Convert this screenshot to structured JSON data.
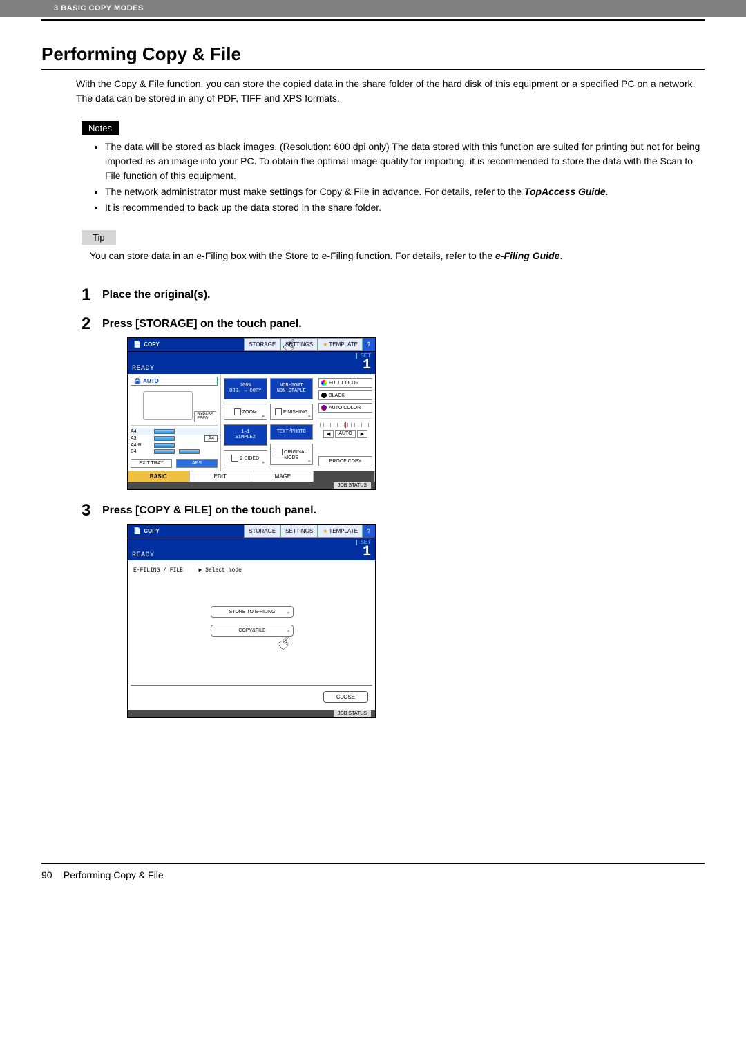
{
  "header": {
    "chapter": "3 BASIC COPY MODES"
  },
  "title": "Performing Copy & File",
  "intro": "With the Copy & File function, you can store the copied data in the share folder of the hard disk of this equipment or a specified PC on a network. The data can be stored in any of PDF, TIFF and XPS formats.",
  "notes": {
    "label": "Notes",
    "items": [
      "The data will be stored as black images. (Resolution: 600 dpi only) The data stored with this function are suited for printing but not for being imported as an image into your PC. To obtain the optimal image quality for importing, it is recommended to store the data with the Scan to File function of this equipment.",
      "The network administrator must make settings for Copy & File in advance. For details, refer to the TopAccess Guide.",
      "It is recommended to back up the data stored in the share folder."
    ],
    "bold_ref1": "TopAccess Guide"
  },
  "tip": {
    "label": "Tip",
    "text_pre": "You can store data in an e-Filing box with the Store to e-Filing function. For details, refer to the ",
    "bold_ref": "e-Filing Guide",
    "text_post": "."
  },
  "steps": [
    {
      "num": "1",
      "title": "Place the original(s)."
    },
    {
      "num": "2",
      "title": "Press [STORAGE] on the touch panel."
    },
    {
      "num": "3",
      "title": "Press [COPY & FILE] on the touch panel."
    }
  ],
  "panel1": {
    "copy_tab": "COPY",
    "storage": "STORAGE",
    "settings": "SETTINGS",
    "template": "TEMPLATE",
    "help": "?",
    "ready": "READY",
    "set": "SET",
    "count": "1",
    "auto": "AUTO",
    "zoom_top": "100%\nORG. → COPY",
    "zoom": "ZOOM",
    "finishing_top": "NON-SORT\nNON-STAPLE",
    "finishing": "FINISHING",
    "simplex_top": "1→1\nSIMPLEX",
    "two_sided": "2-SIDED",
    "text_photo": "TEXT/PHOTO",
    "orig_mode": "ORIGINAL MODE",
    "full_color": "FULL COLOR",
    "black": "BLACK",
    "auto_color": "AUTO COLOR",
    "slider_auto": "AUTO",
    "proof": "PROOF COPY",
    "trays": [
      {
        "sz": "A4"
      },
      {
        "sz": "A3"
      },
      {
        "sz": "A4-R"
      },
      {
        "sz": "B4"
      }
    ],
    "a4_box": "A4",
    "exit_tray": "EXIT TRAY",
    "aps": "APS",
    "tabs": {
      "basic": "BASIC",
      "edit": "EDIT",
      "image": "IMAGE"
    },
    "job_status": "JOB STATUS"
  },
  "panel2": {
    "copy_tab": "COPY",
    "storage": "STORAGE",
    "settings": "SETTINGS",
    "template": "TEMPLATE",
    "help": "?",
    "ready": "READY",
    "set": "SET",
    "count": "1",
    "efiling_label": "E-FILING / FILE",
    "select_mode": "Select mode",
    "store_btn": "STORE TO E-FILING",
    "copyfile_btn": "COPY&FILE",
    "close": "CLOSE",
    "job_status": "JOB STATUS"
  },
  "footer": {
    "page_number": "90",
    "title": "Performing Copy & File"
  }
}
